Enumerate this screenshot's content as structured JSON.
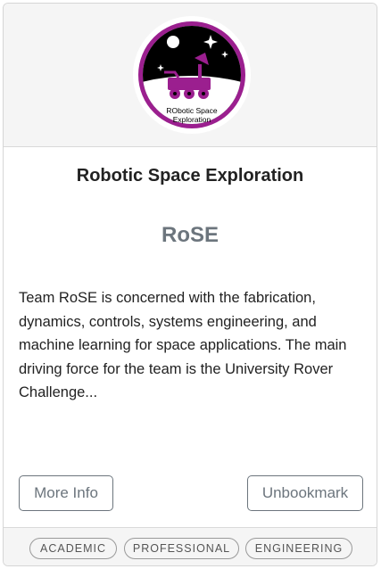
{
  "card": {
    "logo": {
      "icon": "rose-rover-logo-icon",
      "text_line1": "RObotic Space",
      "text_line2": "Exploration",
      "accent": "#9b1f8f"
    },
    "title": "Robotic Space Exploration",
    "acronym": "RoSE",
    "description": "Team RoSE is concerned with the fabrication, dynamics, controls, systems engineering, and machine learning for space applications. The main driving force for the team is the University Rover Challenge...",
    "buttons": {
      "more_info": "More Info",
      "unbookmark": "Unbookmark"
    },
    "tags": [
      "ACADEMIC",
      "PROFESSIONAL",
      "ENGINEERING"
    ]
  }
}
